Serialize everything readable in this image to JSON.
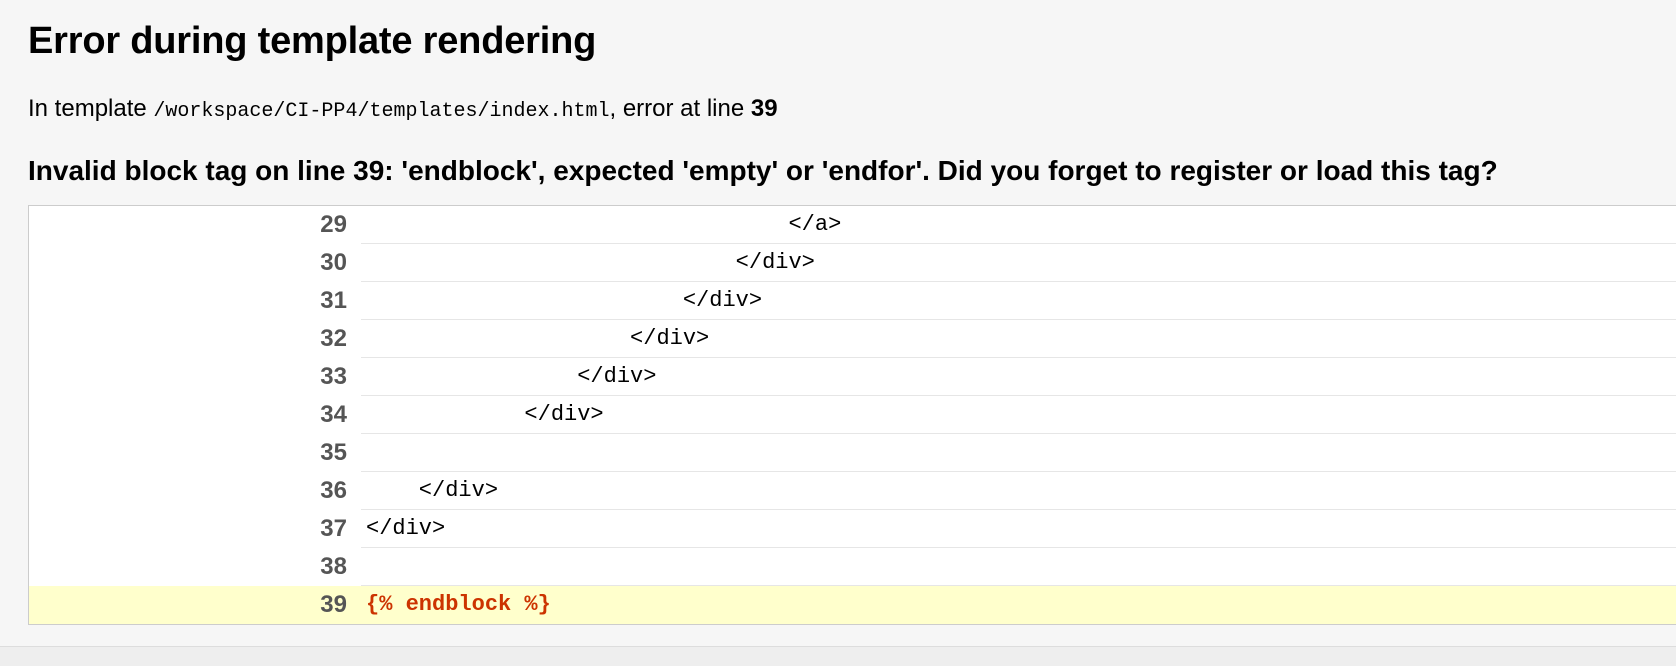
{
  "error": {
    "title": "Error during template rendering",
    "location_prefix": "In template ",
    "template_path": "/workspace/CI-PP4/templates/index.html",
    "location_middle": ", error at line ",
    "line": "39",
    "message": "Invalid block tag on line 39: 'endblock', expected 'empty' or 'endfor'. Did you forget to register or load this tag?"
  },
  "source": {
    "rows": [
      {
        "num": "29",
        "code": "                                </a>"
      },
      {
        "num": "30",
        "code": "                            </div>"
      },
      {
        "num": "31",
        "code": "                        </div>"
      },
      {
        "num": "32",
        "code": "                    </div>"
      },
      {
        "num": "33",
        "code": "                </div>"
      },
      {
        "num": "34",
        "code": "            </div>"
      },
      {
        "num": "35",
        "code": ""
      },
      {
        "num": "36",
        "code": "    </div>"
      },
      {
        "num": "37",
        "code": "</div>"
      },
      {
        "num": "38",
        "code": ""
      },
      {
        "num": "39",
        "code": "{% endblock %}"
      }
    ]
  },
  "colors": {
    "page_background": "#f6f6f6",
    "highlight_background": "#ffffcc",
    "highlight_text": "#cc3300",
    "line_number": "#555555"
  }
}
